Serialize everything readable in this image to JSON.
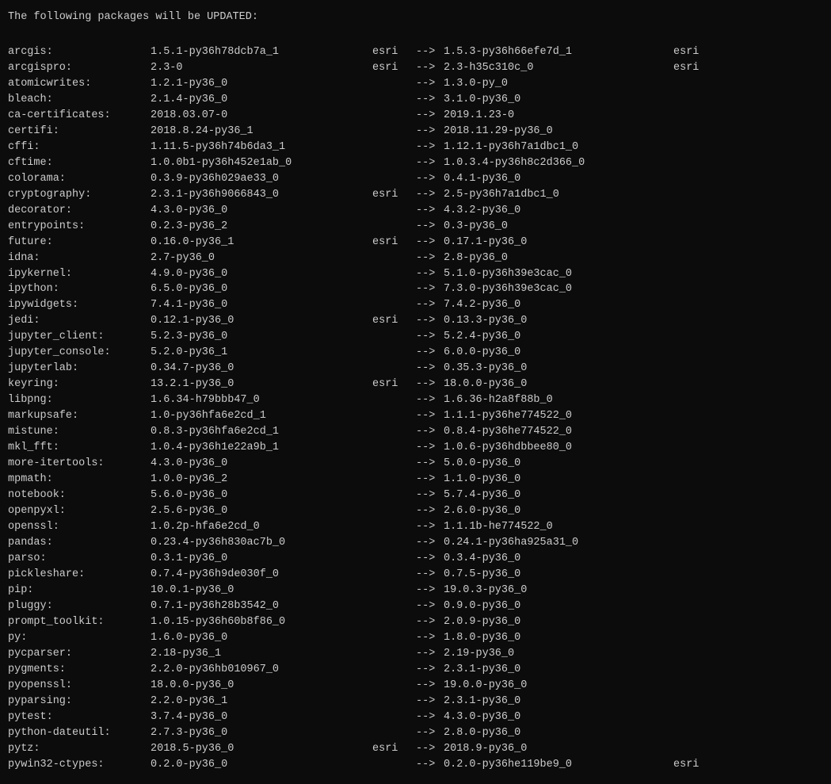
{
  "header": "The following packages will be UPDATED:",
  "packages": [
    {
      "name": "arcgis:",
      "from": "1.5.1-py36h78dcb7a_1",
      "channel_from": "esri",
      "arrow": "-->",
      "to": "1.5.3-py36h66efe7d_1",
      "channel_to": "esri"
    },
    {
      "name": "arcgispro:",
      "from": "2.3-0",
      "channel_from": "esri",
      "arrow": "-->",
      "to": "2.3-h35c310c_0",
      "channel_to": "esri"
    },
    {
      "name": "atomicwrites:",
      "from": "1.2.1-py36_0",
      "channel_from": "",
      "arrow": "-->",
      "to": "1.3.0-py_0",
      "channel_to": ""
    },
    {
      "name": "bleach:",
      "from": "2.1.4-py36_0",
      "channel_from": "",
      "arrow": "-->",
      "to": "3.1.0-py36_0",
      "channel_to": ""
    },
    {
      "name": "ca-certificates:",
      "from": "2018.03.07-0",
      "channel_from": "",
      "arrow": "-->",
      "to": "2019.1.23-0",
      "channel_to": ""
    },
    {
      "name": "certifi:",
      "from": "2018.8.24-py36_1",
      "channel_from": "",
      "arrow": "-->",
      "to": "2018.11.29-py36_0",
      "channel_to": ""
    },
    {
      "name": "cffi:",
      "from": "1.11.5-py36h74b6da3_1",
      "channel_from": "",
      "arrow": "-->",
      "to": "1.12.1-py36h7a1dbc1_0",
      "channel_to": ""
    },
    {
      "name": "cftime:",
      "from": "1.0.0b1-py36h452e1ab_0",
      "channel_from": "",
      "arrow": "-->",
      "to": "1.0.3.4-py36h8c2d366_0",
      "channel_to": ""
    },
    {
      "name": "colorama:",
      "from": "0.3.9-py36h029ae33_0",
      "channel_from": "",
      "arrow": "-->",
      "to": "0.4.1-py36_0",
      "channel_to": ""
    },
    {
      "name": "cryptography:",
      "from": "2.3.1-py36h9066843_0",
      "channel_from": "esri",
      "arrow": "-->",
      "to": "2.5-py36h7a1dbc1_0",
      "channel_to": ""
    },
    {
      "name": "decorator:",
      "from": "4.3.0-py36_0",
      "channel_from": "",
      "arrow": "-->",
      "to": "4.3.2-py36_0",
      "channel_to": ""
    },
    {
      "name": "entrypoints:",
      "from": "0.2.3-py36_2",
      "channel_from": "",
      "arrow": "-->",
      "to": "0.3-py36_0",
      "channel_to": ""
    },
    {
      "name": "future:",
      "from": "0.16.0-py36_1",
      "channel_from": "esri",
      "arrow": "-->",
      "to": "0.17.1-py36_0",
      "channel_to": ""
    },
    {
      "name": "idna:",
      "from": "2.7-py36_0",
      "channel_from": "",
      "arrow": "-->",
      "to": "2.8-py36_0",
      "channel_to": ""
    },
    {
      "name": "ipykernel:",
      "from": "4.9.0-py36_0",
      "channel_from": "",
      "arrow": "-->",
      "to": "5.1.0-py36h39e3cac_0",
      "channel_to": ""
    },
    {
      "name": "ipython:",
      "from": "6.5.0-py36_0",
      "channel_from": "",
      "arrow": "-->",
      "to": "7.3.0-py36h39e3cac_0",
      "channel_to": ""
    },
    {
      "name": "ipywidgets:",
      "from": "7.4.1-py36_0",
      "channel_from": "",
      "arrow": "-->",
      "to": "7.4.2-py36_0",
      "channel_to": ""
    },
    {
      "name": "jedi:",
      "from": "0.12.1-py36_0",
      "channel_from": "esri",
      "arrow": "-->",
      "to": "0.13.3-py36_0",
      "channel_to": ""
    },
    {
      "name": "jupyter_client:",
      "from": "5.2.3-py36_0",
      "channel_from": "",
      "arrow": "-->",
      "to": "5.2.4-py36_0",
      "channel_to": ""
    },
    {
      "name": "jupyter_console:",
      "from": "5.2.0-py36_1",
      "channel_from": "",
      "arrow": "-->",
      "to": "6.0.0-py36_0",
      "channel_to": ""
    },
    {
      "name": "jupyterlab:",
      "from": "0.34.7-py36_0",
      "channel_from": "",
      "arrow": "-->",
      "to": "0.35.3-py36_0",
      "channel_to": ""
    },
    {
      "name": "keyring:",
      "from": "13.2.1-py36_0",
      "channel_from": "esri",
      "arrow": "-->",
      "to": "18.0.0-py36_0",
      "channel_to": ""
    },
    {
      "name": "libpng:",
      "from": "1.6.34-h79bbb47_0",
      "channel_from": "",
      "arrow": "-->",
      "to": "1.6.36-h2a8f88b_0",
      "channel_to": ""
    },
    {
      "name": "markupsafe:",
      "from": "1.0-py36hfa6e2cd_1",
      "channel_from": "",
      "arrow": "-->",
      "to": "1.1.1-py36he774522_0",
      "channel_to": ""
    },
    {
      "name": "mistune:",
      "from": "0.8.3-py36hfa6e2cd_1",
      "channel_from": "",
      "arrow": "-->",
      "to": "0.8.4-py36he774522_0",
      "channel_to": ""
    },
    {
      "name": "mkl_fft:",
      "from": "1.0.4-py36h1e22a9b_1",
      "channel_from": "",
      "arrow": "-->",
      "to": "1.0.6-py36hdbbee80_0",
      "channel_to": ""
    },
    {
      "name": "more-itertools:",
      "from": "4.3.0-py36_0",
      "channel_from": "",
      "arrow": "-->",
      "to": "5.0.0-py36_0",
      "channel_to": ""
    },
    {
      "name": "mpmath:",
      "from": "1.0.0-py36_2",
      "channel_from": "",
      "arrow": "-->",
      "to": "1.1.0-py36_0",
      "channel_to": ""
    },
    {
      "name": "notebook:",
      "from": "5.6.0-py36_0",
      "channel_from": "",
      "arrow": "-->",
      "to": "5.7.4-py36_0",
      "channel_to": ""
    },
    {
      "name": "openpyxl:",
      "from": "2.5.6-py36_0",
      "channel_from": "",
      "arrow": "-->",
      "to": "2.6.0-py36_0",
      "channel_to": ""
    },
    {
      "name": "openssl:",
      "from": "1.0.2p-hfa6e2cd_0",
      "channel_from": "",
      "arrow": "-->",
      "to": "1.1.1b-he774522_0",
      "channel_to": ""
    },
    {
      "name": "pandas:",
      "from": "0.23.4-py36h830ac7b_0",
      "channel_from": "",
      "arrow": "-->",
      "to": "0.24.1-py36ha925a31_0",
      "channel_to": ""
    },
    {
      "name": "parso:",
      "from": "0.3.1-py36_0",
      "channel_from": "",
      "arrow": "-->",
      "to": "0.3.4-py36_0",
      "channel_to": ""
    },
    {
      "name": "pickleshare:",
      "from": "0.7.4-py36h9de030f_0",
      "channel_from": "",
      "arrow": "-->",
      "to": "0.7.5-py36_0",
      "channel_to": ""
    },
    {
      "name": "pip:",
      "from": "10.0.1-py36_0",
      "channel_from": "",
      "arrow": "-->",
      "to": "19.0.3-py36_0",
      "channel_to": ""
    },
    {
      "name": "pluggy:",
      "from": "0.7.1-py36h28b3542_0",
      "channel_from": "",
      "arrow": "-->",
      "to": "0.9.0-py36_0",
      "channel_to": ""
    },
    {
      "name": "prompt_toolkit:",
      "from": "1.0.15-py36h60b8f86_0",
      "channel_from": "",
      "arrow": "-->",
      "to": "2.0.9-py36_0",
      "channel_to": ""
    },
    {
      "name": "py:",
      "from": "1.6.0-py36_0",
      "channel_from": "",
      "arrow": "-->",
      "to": "1.8.0-py36_0",
      "channel_to": ""
    },
    {
      "name": "pycparser:",
      "from": "2.18-py36_1",
      "channel_from": "",
      "arrow": "-->",
      "to": "2.19-py36_0",
      "channel_to": ""
    },
    {
      "name": "pygments:",
      "from": "2.2.0-py36hb010967_0",
      "channel_from": "",
      "arrow": "-->",
      "to": "2.3.1-py36_0",
      "channel_to": ""
    },
    {
      "name": "pyopenssl:",
      "from": "18.0.0-py36_0",
      "channel_from": "",
      "arrow": "-->",
      "to": "19.0.0-py36_0",
      "channel_to": ""
    },
    {
      "name": "pyparsing:",
      "from": "2.2.0-py36_1",
      "channel_from": "",
      "arrow": "-->",
      "to": "2.3.1-py36_0",
      "channel_to": ""
    },
    {
      "name": "pytest:",
      "from": "3.7.4-py36_0",
      "channel_from": "",
      "arrow": "-->",
      "to": "4.3.0-py36_0",
      "channel_to": ""
    },
    {
      "name": "python-dateutil:",
      "from": "2.7.3-py36_0",
      "channel_from": "",
      "arrow": "-->",
      "to": "2.8.0-py36_0",
      "channel_to": ""
    },
    {
      "name": "pytz:",
      "from": "2018.5-py36_0",
      "channel_from": "esri",
      "arrow": "-->",
      "to": "2018.9-py36_0",
      "channel_to": ""
    },
    {
      "name": "pywin32-ctypes:",
      "from": "0.2.0-py36_0",
      "channel_from": "",
      "arrow": "-->",
      "to": "0.2.0-py36he119be9_0",
      "channel_to": "esri"
    }
  ]
}
